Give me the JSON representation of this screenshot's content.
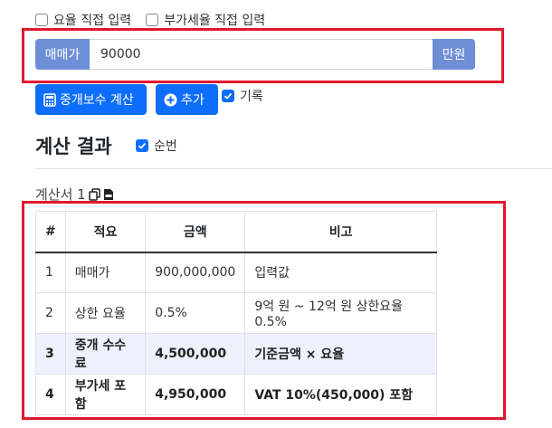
{
  "options": {
    "rate_manual": "요율 직접 입력",
    "vat_manual": "부가세율 직접 입력"
  },
  "price": {
    "label": "매매가",
    "value": "90000",
    "unit": "만원"
  },
  "buttons": {
    "calc": "중개보수 계산",
    "add": "추가"
  },
  "record_label": "기록",
  "result": {
    "heading": "계산 결과",
    "order_label": "순번"
  },
  "statement": {
    "title": "계산서 1"
  },
  "table": {
    "headers": [
      "#",
      "적요",
      "금액",
      "비고"
    ],
    "rows": [
      [
        "1",
        "매매가",
        "900,000,000",
        "입력값"
      ],
      [
        "2",
        "상한 요율",
        "0.5%",
        "9억 원 ~ 12억 원 상한요율 0.5%"
      ],
      [
        "3",
        "중개 수수료",
        "4,500,000",
        "기준금액 × 요율"
      ],
      [
        "4",
        "부가세 포함",
        "4,950,000",
        "VAT 10%(450,000) 포함"
      ]
    ]
  },
  "colors": {
    "primary": "#0d6efd",
    "addon": "#6e8ed6",
    "highlight": "#e0182d"
  }
}
